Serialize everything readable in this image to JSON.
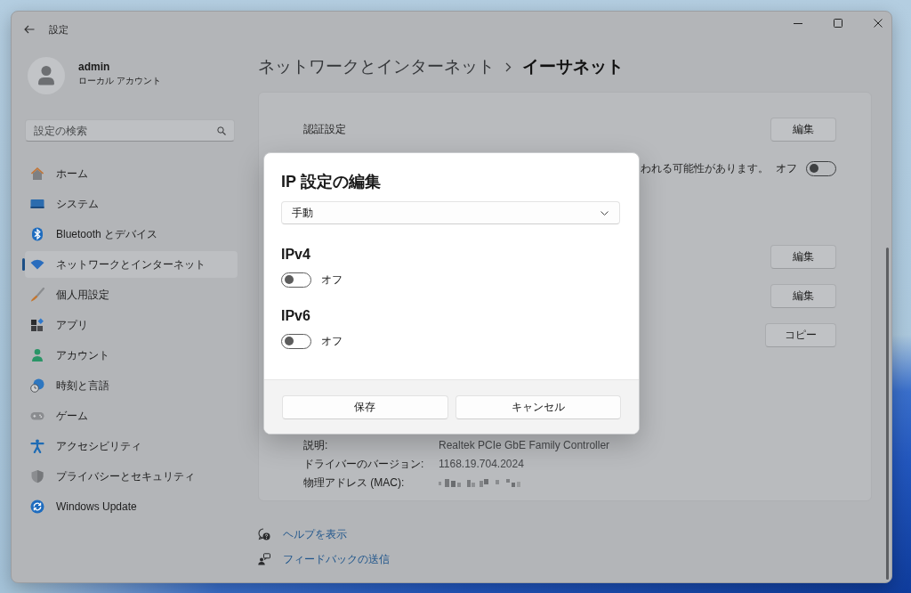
{
  "window": {
    "title": "設定"
  },
  "profile": {
    "name": "admin",
    "account_type": "ローカル アカウント"
  },
  "search": {
    "placeholder": "設定の検索"
  },
  "sidebar": {
    "items": [
      {
        "label": "ホーム",
        "selected": false
      },
      {
        "label": "システム",
        "selected": false
      },
      {
        "label": "Bluetooth とデバイス",
        "selected": false
      },
      {
        "label": "ネットワークとインターネット",
        "selected": true
      },
      {
        "label": "個人用設定",
        "selected": false
      },
      {
        "label": "アプリ",
        "selected": false
      },
      {
        "label": "アカウント",
        "selected": false
      },
      {
        "label": "時刻と言語",
        "selected": false
      },
      {
        "label": "ゲーム",
        "selected": false
      },
      {
        "label": "アクセシビリティ",
        "selected": false
      },
      {
        "label": "プライバシーとセキュリティ",
        "selected": false
      },
      {
        "label": "Windows Update",
        "selected": false
      }
    ]
  },
  "breadcrumb": {
    "parent": "ネットワークとインターネット",
    "current": "イーサネット"
  },
  "settings": {
    "sections": [
      {
        "rows": [
          {
            "kind": "button",
            "label": "認証設定",
            "button": "編集"
          },
          {
            "kind": "toggle",
            "description": "われる可能性があります。",
            "state_label": "オフ",
            "on": false
          }
        ]
      },
      {
        "rows": [
          {
            "kind": "button",
            "button": "編集"
          },
          {
            "kind": "button",
            "button": "編集"
          },
          {
            "kind": "button",
            "button": "コピー"
          }
        ]
      }
    ],
    "properties": [
      {
        "label": "説明:",
        "value": "Realtek PCIe GbE Family Controller"
      },
      {
        "label": "ドライバーのバージョン:",
        "value": "1168.19.704.2024"
      },
      {
        "label": "物理アドレス (MAC):",
        "redacted": true
      }
    ]
  },
  "help_links": [
    {
      "label": "ヘルプを表示"
    },
    {
      "label": "フィードバックの送信"
    }
  ],
  "dialog": {
    "title": "IP 設定の編集",
    "dropdown": {
      "value": "手動"
    },
    "sections": [
      {
        "heading": "IPv4",
        "on": false,
        "state_label": "オフ"
      },
      {
        "heading": "IPv6",
        "on": false,
        "state_label": "オフ"
      }
    ],
    "buttons": [
      {
        "label": "保存"
      },
      {
        "label": "キャンセル"
      }
    ]
  }
}
